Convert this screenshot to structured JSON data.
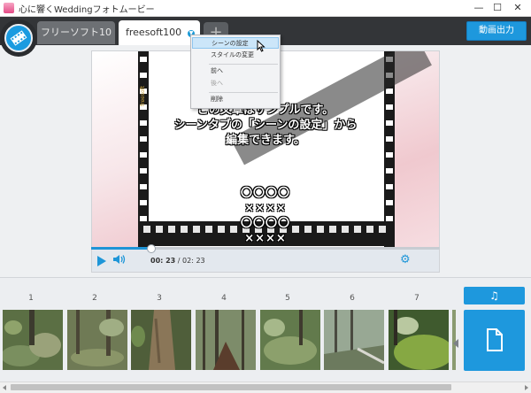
{
  "window": {
    "title": "心に響くWeddingフォトムービー",
    "controls": [
      "—",
      "☐",
      "✕"
    ]
  },
  "tabs": [
    {
      "label": "フリーソフト10",
      "active": false
    },
    {
      "label": "freesoft100",
      "active": true
    }
  ],
  "add_tab_label": "+",
  "export_button": "動画出力",
  "context_menu": {
    "items": [
      {
        "label": "シーンの設定",
        "selected": true,
        "disabled": false
      },
      {
        "label": "スタイルの変更",
        "selected": false,
        "disabled": false
      },
      {
        "label": "前へ",
        "selected": false,
        "disabled": false
      },
      {
        "label": "後へ",
        "selected": false,
        "disabled": true
      },
      {
        "label": "削除",
        "selected": false,
        "disabled": false
      }
    ]
  },
  "preview": {
    "text_lines": [
      "この文章はサンプルです。",
      "シーンタブの「シーンの設定」から",
      "編集できます。"
    ],
    "symbol_lines": [
      "〇〇〇〇",
      "××××",
      "〇〇〇〇",
      "××××"
    ],
    "film_label": "freesoft"
  },
  "player": {
    "current_time": "00: 23",
    "total_time": " / 02: 23",
    "progress": 0.17,
    "icons": {
      "play": "play-icon",
      "volume": "volume-icon",
      "settings": "gear-icon"
    }
  },
  "timeline": {
    "scenes": [
      {
        "number": "1",
        "color": "#5b6f44"
      },
      {
        "number": "2",
        "color": "#6f7a55"
      },
      {
        "number": "3",
        "color": "#7a6a4f"
      },
      {
        "number": "4",
        "color": "#4f6a3c"
      },
      {
        "number": "5",
        "color": "#5f7a4a"
      },
      {
        "number": "6",
        "color": "#6c7a68"
      },
      {
        "number": "7",
        "color": "#3f5a2e"
      }
    ],
    "music_icon": "music-note-icon",
    "add_icon": "document-icon"
  },
  "colors": {
    "accent": "#1e98dd",
    "dark_bar": "#333538"
  }
}
